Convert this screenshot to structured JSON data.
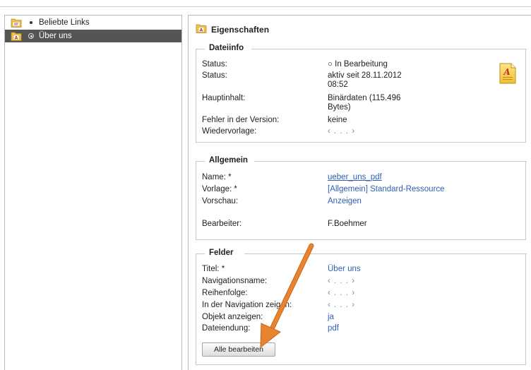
{
  "tree": {
    "items": [
      {
        "label": "Beliebte Links",
        "icon": "link-folder-icon",
        "selected": false
      },
      {
        "label": "Über uns",
        "icon": "document-folder-icon",
        "selected": true
      }
    ]
  },
  "properties": {
    "title": "Eigenschaften",
    "dateiinfo": {
      "legend": "Dateiinfo",
      "status1_label": "Status:",
      "status1_value": "○ In Bearbeitung",
      "status2_label": "Status:",
      "status2_value_line1": "aktiv seit 28.11.2012",
      "status2_value_line2": "08:52",
      "hauptinhalt_label": "Hauptinhalt:",
      "hauptinhalt_value_line1": "Binärdaten (115.496",
      "hauptinhalt_value_line2": "Bytes)",
      "fehler_label": "Fehler in der Version:",
      "fehler_value": "keine",
      "wiedervorlage_label": "Wiedervorlage:",
      "wiedervorlage_value": "‹ . . . ›"
    },
    "allgemein": {
      "legend": "Allgemein",
      "name_label": "Name: *",
      "name_value": "ueber_uns_pdf",
      "vorlage_label": "Vorlage: *",
      "vorlage_value": "[Allgemein] Standard-Ressource",
      "vorschau_label": "Vorschau:",
      "vorschau_value": "Anzeigen",
      "bearbeiter_label": "Bearbeiter:",
      "bearbeiter_value": "F.Boehmer"
    },
    "felder": {
      "legend": "Felder",
      "titel_label": "Titel: *",
      "titel_value": "Über uns",
      "navname_label": "Navigationsname:",
      "navname_value": "‹ . . . ›",
      "reihenfolge_label": "Reihenfolge:",
      "reihenfolge_value": "‹ . . . ›",
      "innav_label": "In der Navigation zeigen:",
      "innav_value": "‹ . . . ›",
      "objekt_label": "Objekt anzeigen:",
      "objekt_value": "ja",
      "endung_label": "Dateiendung:",
      "endung_value": "pdf",
      "button_label": "Alle bearbeiten"
    }
  },
  "colors": {
    "selection_bg": "#555555",
    "link": "#2f5fb3",
    "annotation_arrow": "#e0782a"
  }
}
